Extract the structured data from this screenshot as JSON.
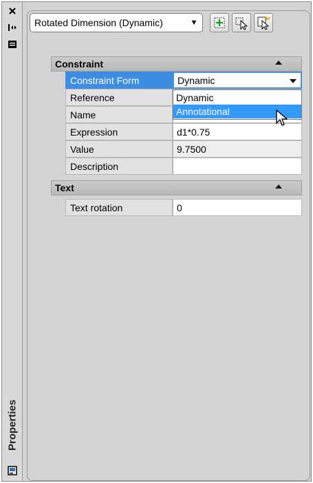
{
  "palette": {
    "window_title": "Properties"
  },
  "toolbar": {
    "object_type": "Rotated Dimension (Dynamic)",
    "buttons": [
      {
        "icon": "toggle-pickadd-icon"
      },
      {
        "icon": "select-objects-icon"
      },
      {
        "icon": "quick-select-icon"
      }
    ]
  },
  "sections": [
    {
      "title": "Constraint",
      "rows": [
        {
          "label": "Constraint Form",
          "value": "Dynamic"
        },
        {
          "label": "Reference",
          "value": ""
        },
        {
          "label": "Name",
          "value": ""
        },
        {
          "label": "Expression",
          "value": "d1*0.75"
        },
        {
          "label": "Value",
          "value": "9.7500"
        },
        {
          "label": "Description",
          "value": ""
        }
      ]
    },
    {
      "title": "Text",
      "rows": [
        {
          "label": "Text rotation",
          "value": "0"
        }
      ]
    }
  ],
  "dropdown": {
    "options": [
      "Dynamic",
      "Annotational"
    ],
    "highlighted": "Annotational"
  },
  "colors": {
    "selection": "#3d8ee0",
    "highlight": "#3399ff"
  }
}
